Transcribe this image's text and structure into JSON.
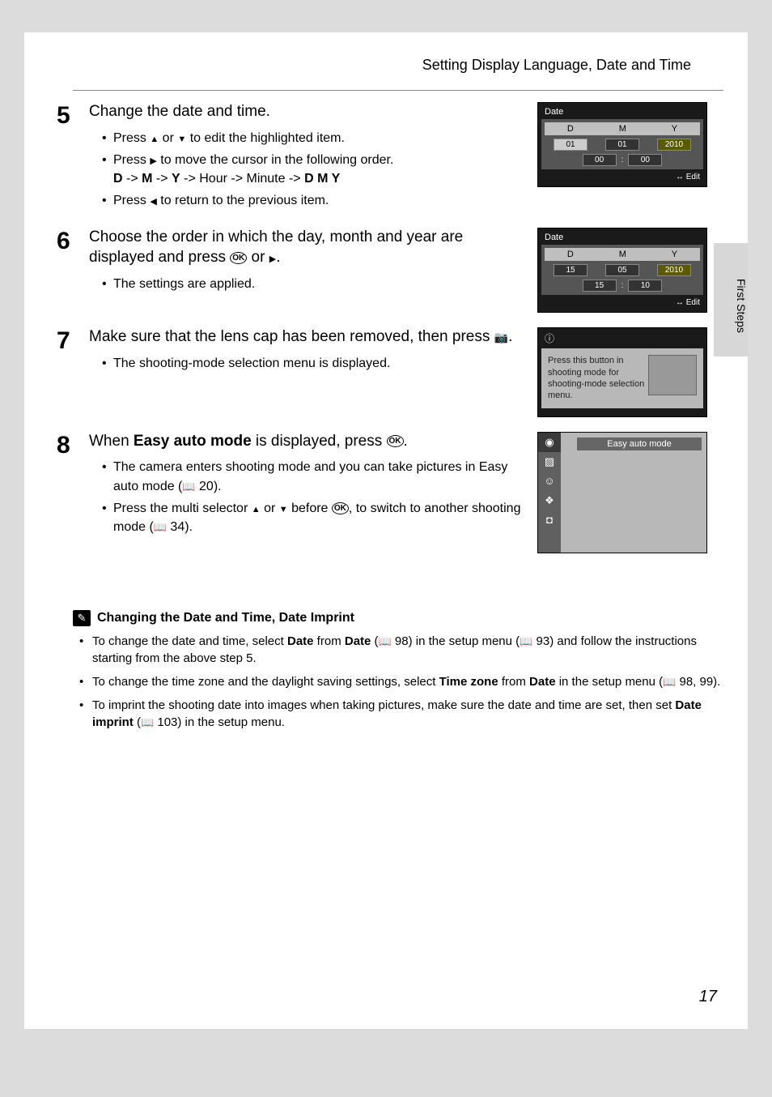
{
  "header": {
    "title": "Setting Display Language, Date and Time"
  },
  "sideTab": "First Steps",
  "pageNumber": "17",
  "steps": {
    "s5": {
      "num": "5",
      "title": "Change the date and time.",
      "b1_a": "Press ",
      "b1_b": " or ",
      "b1_c": " to edit the highlighted item.",
      "b2_a": "Press ",
      "b2_b": " to move the cursor in the following order.",
      "b2_seq_a": "D",
      "b2_seq_b": " -> ",
      "b2_seq_c": "M",
      "b2_seq_d": " -> ",
      "b2_seq_e": "Y",
      "b2_seq_f": " -> Hour -> Minute -> ",
      "b2_seq_g": "D M Y",
      "b3_a": "Press ",
      "b3_b": " to return to the previous item."
    },
    "s6": {
      "num": "6",
      "title_a": "Choose the order in which the day, month and year are displayed and press ",
      "title_b": " or ",
      "title_c": ".",
      "b1": "The settings are applied."
    },
    "s7": {
      "num": "7",
      "title_a": "Make sure that the lens cap has been removed, then press ",
      "title_b": ".",
      "b1": "The shooting-mode selection menu is displayed."
    },
    "s8": {
      "num": "8",
      "title_a": "When ",
      "title_b": "Easy auto mode",
      "title_c": " is displayed, press ",
      "title_d": ".",
      "b1_a": "The camera enters shooting mode and you can take pictures in Easy auto mode (",
      "b1_b": " 20).",
      "b2_a": "Press the multi selector ",
      "b2_b": " or ",
      "b2_c": " before ",
      "b2_d": ", to switch to another shooting mode (",
      "b2_e": " 34)."
    }
  },
  "screens": {
    "date1": {
      "title": "Date",
      "D": "D",
      "M": "M",
      "Y": "Y",
      "d": "01",
      "m": "01",
      "y": "2010",
      "hh": "00",
      "mm": "00",
      "edit": "Edit"
    },
    "date2": {
      "title": "Date",
      "D": "D",
      "M": "M",
      "Y": "Y",
      "d": "15",
      "m": "05",
      "y": "2010",
      "hh": "15",
      "mm": "10",
      "edit": "Edit"
    },
    "info": {
      "text": "Press this button in shooting mode for shooting-mode selection menu."
    },
    "mode": {
      "label": "Easy auto mode"
    }
  },
  "note": {
    "title": "Changing the Date and Time, Date Imprint",
    "b1_a": "To change the date and time, select ",
    "b1_b": "Date",
    "b1_c": " from ",
    "b1_d": "Date",
    "b1_e": " (",
    "b1_f": " 98) in the setup menu (",
    "b1_g": " 93) and follow the instructions starting from the above step 5.",
    "b2_a": "To change the time zone and the daylight saving settings, select ",
    "b2_b": "Time zone",
    "b2_c": " from ",
    "b2_d": "Date",
    "b2_e": " in the setup menu (",
    "b2_f": " 98, 99).",
    "b3_a": "To imprint the shooting date into images when taking pictures, make sure the date and time are set, then set ",
    "b3_b": "Date imprint",
    "b3_c": " (",
    "b3_d": " 103) in the setup menu."
  }
}
